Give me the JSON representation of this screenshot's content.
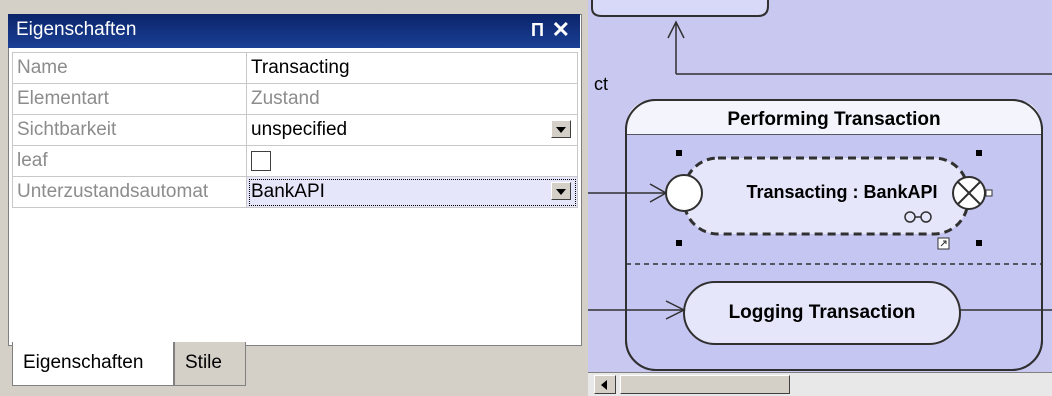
{
  "panel": {
    "title": "Eigenschaften",
    "pin_glyph": "Π",
    "close_glyph": "✕",
    "rows": [
      {
        "label": "Name",
        "value": "Transacting"
      },
      {
        "label": "Elementart",
        "value": "Zustand"
      },
      {
        "label": "Sichtbarkeit",
        "value": "unspecified"
      },
      {
        "label": "leaf",
        "value": ""
      },
      {
        "label": "Unterzustandsautomat",
        "value": "BankAPI"
      }
    ],
    "tabs": [
      "Eigenschaften",
      "Stile"
    ]
  },
  "diagram": {
    "fragment_text": "ct",
    "composite_title": "Performing Transaction",
    "submachine_state": "Transacting : BankAPI",
    "logging_state": "Logging Transaction",
    "colors": {
      "region": "#c8c8f2",
      "state_fill": "#e0e0f8",
      "stroke": "#303030"
    }
  }
}
